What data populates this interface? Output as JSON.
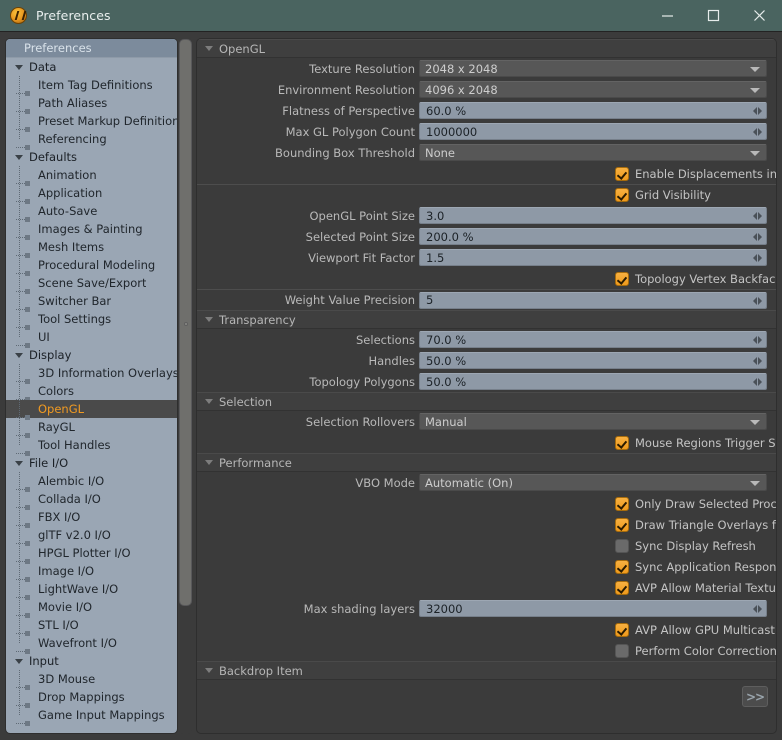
{
  "window": {
    "title": "Preferences",
    "app_icon": "modo-app-icon",
    "accent_color": "#f09a22",
    "titlebar_color": "#4a6460",
    "controls": [
      {
        "name": "minimize",
        "glyph": "minimize-icon"
      },
      {
        "name": "maximize",
        "glyph": "maximize-icon"
      },
      {
        "name": "close",
        "glyph": "close-icon"
      }
    ]
  },
  "sidebar": {
    "header": "Preferences",
    "selected": "OpenGL",
    "items": [
      {
        "label": "Data",
        "type": "group"
      },
      {
        "label": "Item Tag Definitions",
        "type": "child"
      },
      {
        "label": "Path Aliases",
        "type": "child"
      },
      {
        "label": "Preset Markup Definitions",
        "type": "child"
      },
      {
        "label": "Referencing",
        "type": "child"
      },
      {
        "label": "Defaults",
        "type": "group"
      },
      {
        "label": "Animation",
        "type": "child"
      },
      {
        "label": "Application",
        "type": "child"
      },
      {
        "label": "Auto-Save",
        "type": "child"
      },
      {
        "label": "Images & Painting",
        "type": "child"
      },
      {
        "label": "Mesh Items",
        "type": "child"
      },
      {
        "label": "Procedural Modeling",
        "type": "child"
      },
      {
        "label": "Scene Save/Export",
        "type": "child"
      },
      {
        "label": "Switcher Bar",
        "type": "child"
      },
      {
        "label": "Tool Settings",
        "type": "child"
      },
      {
        "label": "UI",
        "type": "child"
      },
      {
        "label": "Display",
        "type": "group"
      },
      {
        "label": "3D Information Overlays",
        "type": "child"
      },
      {
        "label": "Colors",
        "type": "child"
      },
      {
        "label": "OpenGL",
        "type": "child",
        "selected": true
      },
      {
        "label": "RayGL",
        "type": "child"
      },
      {
        "label": "Tool Handles",
        "type": "child"
      },
      {
        "label": "File I/O",
        "type": "group"
      },
      {
        "label": "Alembic I/O",
        "type": "child"
      },
      {
        "label": "Collada I/O",
        "type": "child"
      },
      {
        "label": "FBX I/O",
        "type": "child"
      },
      {
        "label": "glTF v2.0 I/O",
        "type": "child"
      },
      {
        "label": "HPGL Plotter I/O",
        "type": "child"
      },
      {
        "label": "Image I/O",
        "type": "child"
      },
      {
        "label": "LightWave I/O",
        "type": "child"
      },
      {
        "label": "Movie I/O",
        "type": "child"
      },
      {
        "label": "STL I/O",
        "type": "child"
      },
      {
        "label": "Wavefront I/O",
        "type": "child"
      },
      {
        "label": "Input",
        "type": "group"
      },
      {
        "label": "3D Mouse",
        "type": "child"
      },
      {
        "label": "Drop Mappings",
        "type": "child"
      },
      {
        "label": "Game Input Mappings",
        "type": "child"
      }
    ]
  },
  "main": {
    "blocks": [
      {
        "kind": "section",
        "label": "OpenGL"
      },
      {
        "kind": "dropdown",
        "label": "Texture Resolution",
        "value": "2048 x 2048"
      },
      {
        "kind": "dropdown",
        "label": "Environment Resolution",
        "value": "4096 x 2048"
      },
      {
        "kind": "numeric",
        "label": "Flatness of Perspective",
        "value": "60.0 %"
      },
      {
        "kind": "numeric",
        "label": "Max GL Polygon Count",
        "value": "1000000"
      },
      {
        "kind": "dropdown",
        "label": "Bounding Box Threshold",
        "value": "None"
      },
      {
        "kind": "checkbox",
        "label": "Enable Displacements in GL",
        "checked": true
      },
      {
        "kind": "checkbox",
        "label": "Grid Visibility",
        "checked": true,
        "divider": true
      },
      {
        "kind": "numeric",
        "label": "OpenGL Point Size",
        "value": "3.0"
      },
      {
        "kind": "numeric",
        "label": "Selected Point Size",
        "value": "200.0 %"
      },
      {
        "kind": "numeric",
        "label": "Viewport Fit Factor",
        "value": "1.5"
      },
      {
        "kind": "checkbox",
        "label": "Topology Vertex Backface Culling",
        "checked": true
      },
      {
        "kind": "numeric",
        "label": "Weight Value Precision",
        "value": "5",
        "divider": true
      },
      {
        "kind": "section",
        "label": "Transparency"
      },
      {
        "kind": "numeric",
        "label": "Selections",
        "value": "70.0 %"
      },
      {
        "kind": "numeric",
        "label": "Handles",
        "value": "50.0 %"
      },
      {
        "kind": "numeric",
        "label": "Topology Polygons",
        "value": "50.0 %"
      },
      {
        "kind": "section",
        "label": "Selection"
      },
      {
        "kind": "dropdown",
        "label": "Selection Rollovers",
        "value": "Manual"
      },
      {
        "kind": "checkbox",
        "label": "Mouse Regions Trigger Selection",
        "checked": true
      },
      {
        "kind": "section",
        "label": "Performance"
      },
      {
        "kind": "dropdown",
        "label": "VBO Mode",
        "value": "Automatic (On)"
      },
      {
        "kind": "checkbox",
        "label": "Only Draw Selected Procedural Outlines",
        "checked": true
      },
      {
        "kind": "checkbox",
        "label": "Draw Triangle Overlays for Procedural Meshes",
        "checked": true
      },
      {
        "kind": "checkbox",
        "label": "Sync Display Refresh",
        "checked": false
      },
      {
        "kind": "checkbox",
        "label": "Sync Application Response",
        "checked": true
      },
      {
        "kind": "checkbox",
        "label": "AVP Allow Material Texture storage",
        "checked": true
      },
      {
        "kind": "numeric",
        "label": "Max shading layers",
        "value": "32000"
      },
      {
        "kind": "checkbox",
        "label": "AVP Allow GPU Multicast",
        "checked": true
      },
      {
        "kind": "checkbox",
        "label": "Perform Color Correction on OpenGL Objects",
        "checked": false
      },
      {
        "kind": "section",
        "label": "Backdrop Item"
      },
      {
        "kind": "forward",
        "label": ">>"
      }
    ]
  }
}
